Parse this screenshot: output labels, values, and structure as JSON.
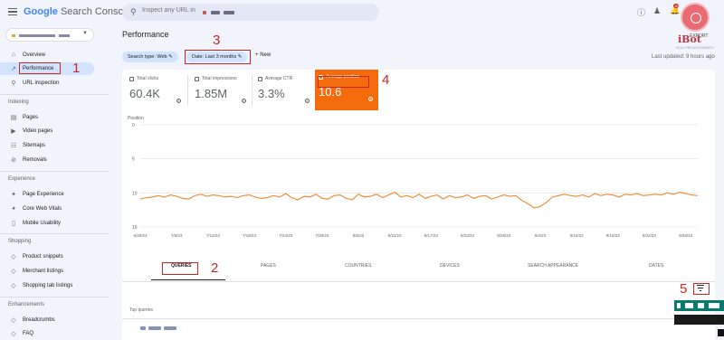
{
  "brand": {
    "google": "Google",
    "product": "Search Console"
  },
  "search": {
    "placeholder": "Inspect any URL in"
  },
  "notifications": {
    "count": "10"
  },
  "watermark": {
    "name": "iBot",
    "subtitle": "SKILL PRO ALIVEMONTH"
  },
  "header": {
    "export_label": "EXPORT"
  },
  "sidebar": {
    "overview": "Overview",
    "performance": "Performance",
    "url_inspection": "URL inspection",
    "sections": {
      "indexing": "Indexing",
      "experience": "Experience",
      "shopping": "Shopping",
      "enhancements": "Enhancements"
    },
    "indexing_items": [
      "Pages",
      "Video pages",
      "Sitemaps",
      "Removals"
    ],
    "experience_items": [
      "Page Experience",
      "Core Web Vitals",
      "Mobile Usability"
    ],
    "shopping_items": [
      "Product snippets",
      "Merchant listings",
      "Shopping tab listings"
    ],
    "enhancement_items": [
      "Breadcrumbs",
      "FAQ"
    ]
  },
  "main": {
    "title": "Performance",
    "filters": {
      "search_type": "Search type: Web",
      "date": "Date: Last 3 months",
      "new_label": "New"
    },
    "last_updated": "Last updated: 9 hours ago"
  },
  "metrics": [
    {
      "label": "Total clicks",
      "value": "60.4K",
      "selected": false
    },
    {
      "label": "Total impressions",
      "value": "1.85M",
      "selected": false
    },
    {
      "label": "Average CTR",
      "value": "3.3%",
      "selected": false
    },
    {
      "label": "Average position",
      "value": "10.6",
      "selected": true
    }
  ],
  "tabs": {
    "items": [
      "QUERIES",
      "PAGES",
      "COUNTRIES",
      "DEVICES",
      "SEARCH APPEARANCE",
      "DATES"
    ],
    "active": "QUERIES"
  },
  "table": {
    "header": "Top queries"
  },
  "annotations": [
    "1",
    "2",
    "3",
    "4",
    "5"
  ],
  "colors": {
    "accent": "#1a73e8",
    "selected_metric": "#f36b0c",
    "line": "#e8913a",
    "annotation": "#c62828"
  },
  "chart_data": {
    "type": "line",
    "ylabel": "Position",
    "y_ticks": [
      "0",
      "5",
      "10",
      "15"
    ],
    "ylim": [
      0,
      15
    ],
    "y_inverted": true,
    "x_tick_labels": [
      "6/30/23",
      "7/6/23",
      "7/12/23",
      "7/18/23",
      "7/24/23",
      "7/30/23",
      "8/5/23",
      "8/11/23",
      "8/17/23",
      "8/23/23",
      "8/29/23",
      "9/4/23",
      "9/10/23",
      "9/16/23",
      "9/22/23",
      "9/28/23"
    ],
    "x": [
      "6/30/23",
      "7/1/23",
      "7/2/23",
      "7/3/23",
      "7/4/23",
      "7/5/23",
      "7/6/23",
      "7/7/23",
      "7/8/23",
      "7/9/23",
      "7/10/23",
      "7/11/23",
      "7/12/23",
      "7/13/23",
      "7/14/23",
      "7/15/23",
      "7/16/23",
      "7/17/23",
      "7/18/23",
      "7/19/23",
      "7/20/23",
      "7/21/23",
      "7/22/23",
      "7/23/23",
      "7/24/23",
      "7/25/23",
      "7/26/23",
      "7/27/23",
      "7/28/23",
      "7/29/23",
      "7/30/23",
      "7/31/23",
      "8/1/23",
      "8/2/23",
      "8/3/23",
      "8/4/23",
      "8/5/23",
      "8/6/23",
      "8/7/23",
      "8/8/23",
      "8/9/23",
      "8/10/23",
      "8/11/23",
      "8/12/23",
      "8/13/23",
      "8/14/23",
      "8/15/23",
      "8/16/23",
      "8/17/23",
      "8/18/23",
      "8/19/23",
      "8/20/23",
      "8/21/23",
      "8/22/23",
      "8/23/23",
      "8/24/23",
      "8/25/23",
      "8/26/23",
      "8/27/23",
      "8/28/23",
      "8/29/23",
      "8/30/23",
      "8/31/23",
      "9/1/23",
      "9/2/23",
      "9/3/23",
      "9/4/23",
      "9/5/23",
      "9/6/23",
      "9/7/23",
      "9/8/23",
      "9/9/23",
      "9/10/23",
      "9/11/23",
      "9/12/23",
      "9/13/23",
      "9/14/23",
      "9/15/23",
      "9/16/23",
      "9/17/23",
      "9/18/23",
      "9/19/23",
      "9/20/23",
      "9/21/23",
      "9/22/23",
      "9/23/23",
      "9/24/23",
      "9/25/23",
      "9/26/23",
      "9/27/23",
      "9/28/23",
      "9/29/23",
      "9/30/23"
    ],
    "series": [
      {
        "values": [
          10.9,
          10.7,
          10.6,
          10.4,
          10.6,
          10.3,
          10.5,
          10.8,
          10.9,
          10.4,
          10.2,
          10.5,
          10.3,
          10.4,
          10.6,
          10.5,
          10.7,
          10.4,
          10.3,
          10.6,
          10.8,
          10.7,
          10.4,
          10.6,
          10.1,
          10.7,
          11.0,
          10.5,
          10.6,
          10.2,
          10.8,
          10.9,
          10.4,
          10.3,
          10.8,
          11.0,
          10.2,
          10.6,
          10.5,
          10.2,
          10.7,
          10.3,
          9.9,
          10.6,
          10.4,
          10.7,
          10.2,
          10.8,
          10.5,
          10.3,
          10.9,
          10.4,
          10.7,
          10.6,
          10.3,
          10.8,
          10.5,
          10.4,
          10.9,
          10.6,
          10.3,
          10.5,
          10.4,
          11.1,
          11.6,
          12.2,
          12.0,
          11.4,
          10.6,
          10.4,
          10.2,
          10.4,
          10.5,
          10.3,
          10.6,
          10.1,
          10.4,
          10.2,
          10.3,
          10.6,
          10.2,
          10.3,
          10.1,
          10.4,
          10.3,
          10.2,
          10.3,
          10.0,
          10.2,
          9.9,
          10.1,
          10.3,
          10.4
        ]
      }
    ],
    "grid": true,
    "legend": "none"
  }
}
